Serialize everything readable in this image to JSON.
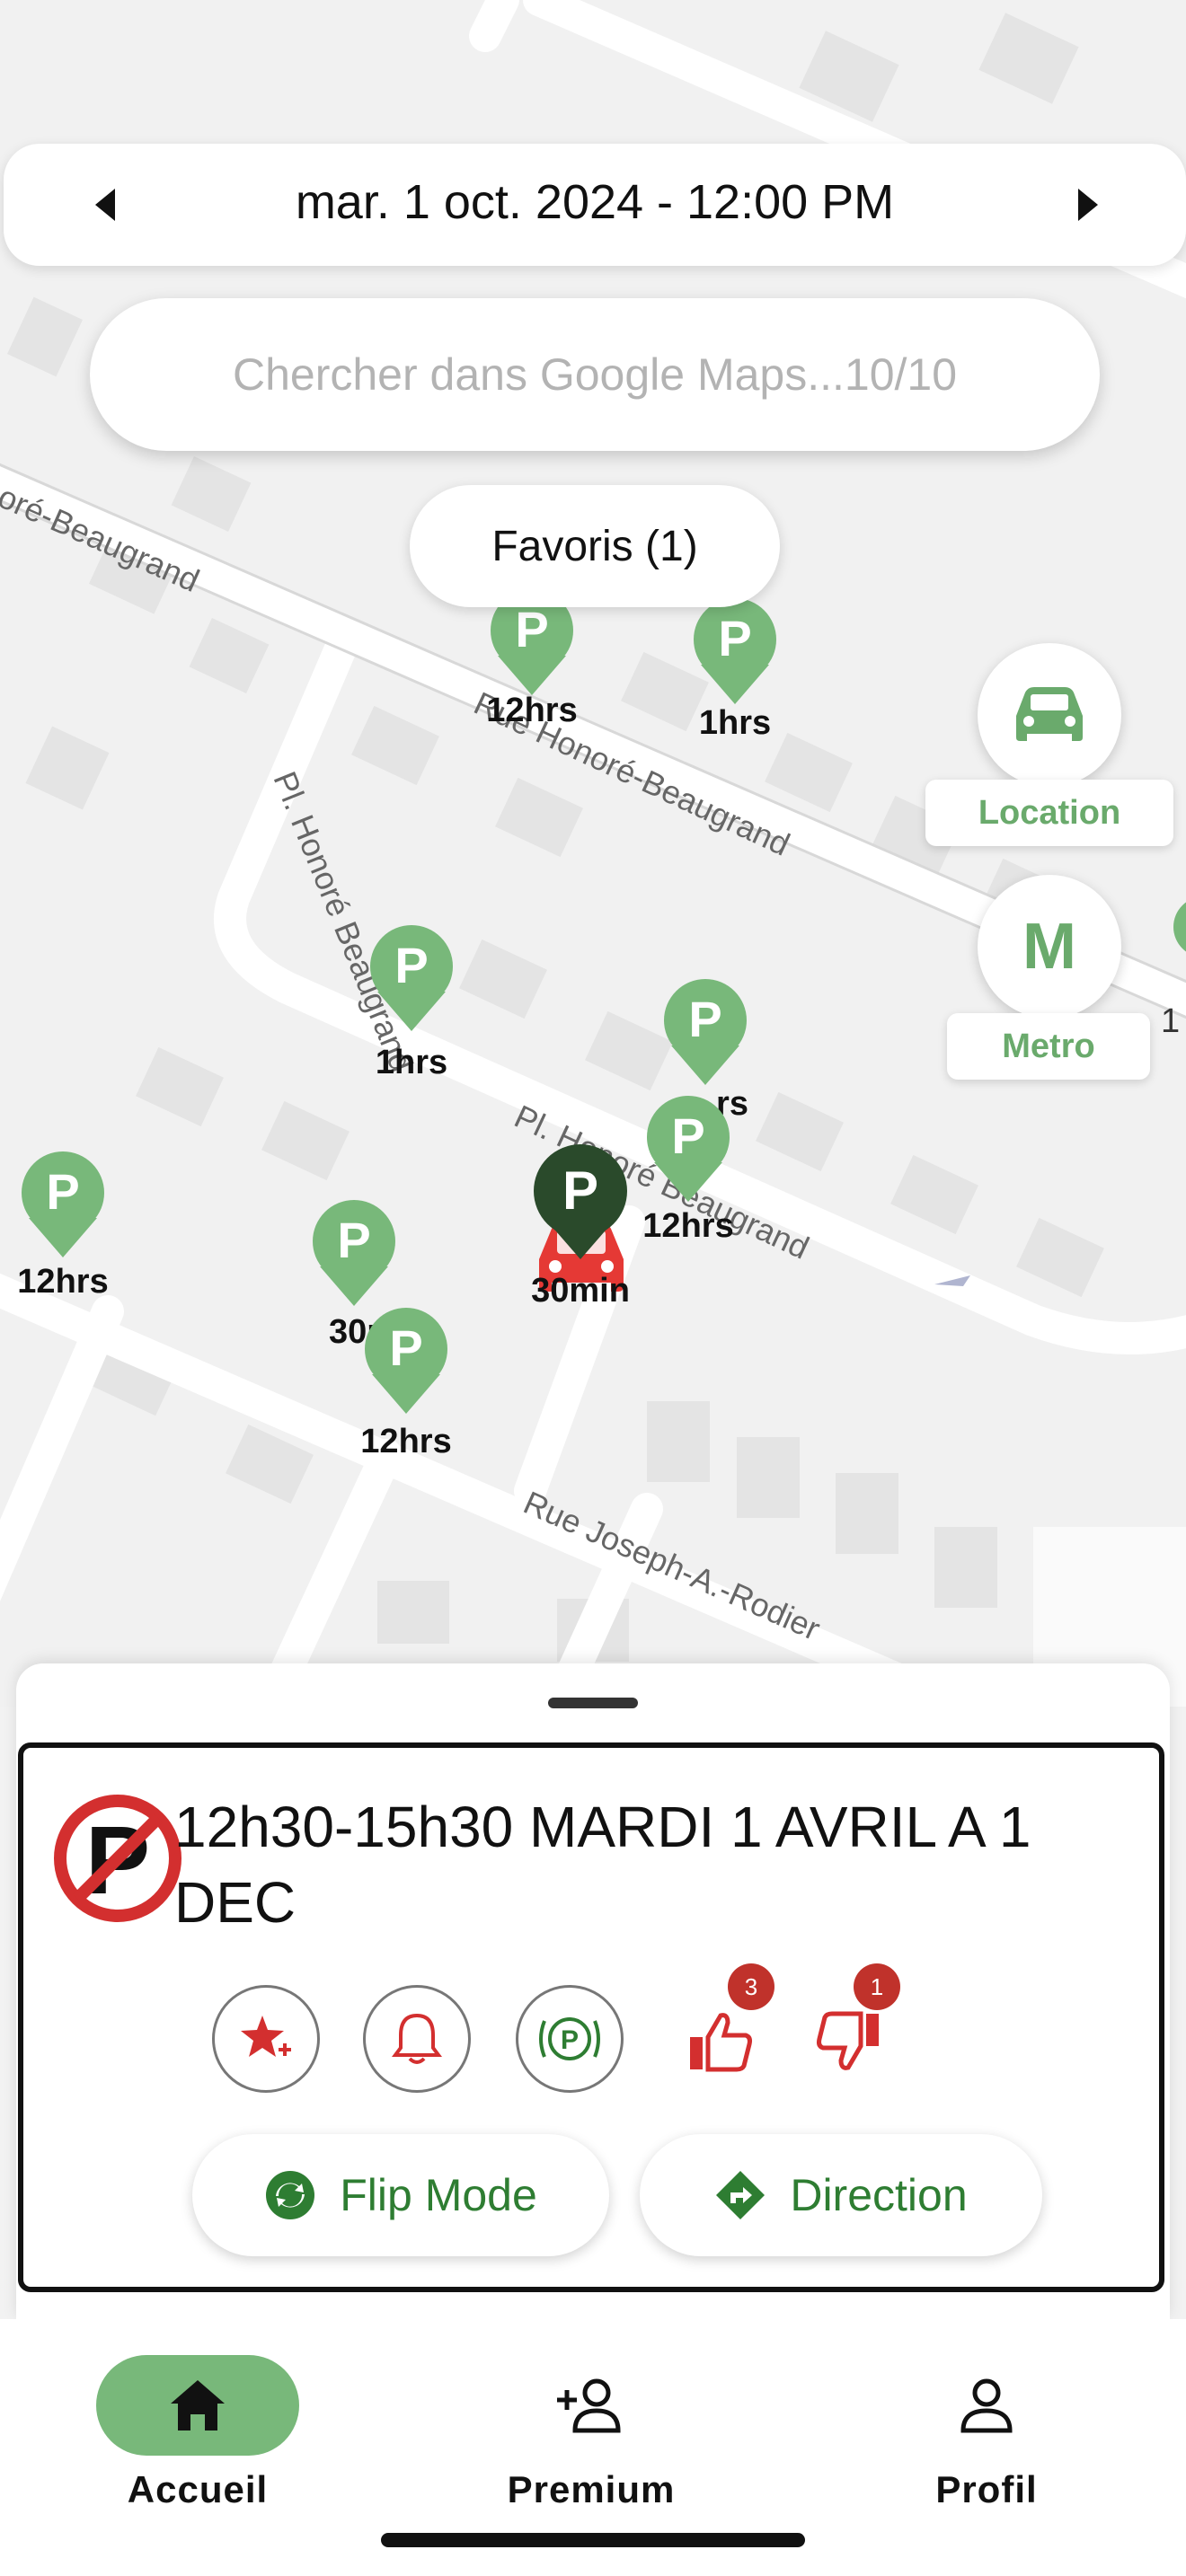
{
  "date_bar": {
    "text": "mar. 1 oct. 2024 - 12:00 PM"
  },
  "search": {
    "placeholder": "Chercher dans Google Maps...10/10"
  },
  "favorites": {
    "label": "Favoris (1)"
  },
  "streets": [
    "oré-Beaugrand",
    "Rue Honoré-Beaugrand",
    "Pl. Honoré Beaugrand",
    "Pl. Honoré Beaugrand",
    "Rue Joseph-A.-Rodier"
  ],
  "pins": [
    {
      "label": "12hrs",
      "color": "#78b87a"
    },
    {
      "label": "1hrs",
      "color": "#78b87a"
    },
    {
      "label": "1hrs",
      "color": "#78b87a"
    },
    {
      "label": "rs",
      "color": "#78b87a"
    },
    {
      "label": "12hrs",
      "color": "#78b87a"
    },
    {
      "label": "12hrs",
      "color": "#78b87a"
    },
    {
      "label": "30m",
      "color": "#78b87a"
    },
    {
      "label": "12hrs",
      "color": "#78b87a"
    },
    {
      "label": "30min",
      "color": "#2a4a2b"
    }
  ],
  "edge_label": "1",
  "side_buttons": {
    "location": {
      "label": "Location",
      "icon": "car-icon"
    },
    "metro": {
      "label": "Metro",
      "letter": "M"
    }
  },
  "sheet": {
    "title": "12h30-15h30 MARDI 1 AVRIL A 1 DEC",
    "icon": "no-parking-icon",
    "actions": [
      {
        "name": "favorite-add",
        "icon": "star-plus-icon"
      },
      {
        "name": "alarm",
        "icon": "bell-icon"
      },
      {
        "name": "parking",
        "icon": "parking-circle-icon"
      }
    ],
    "likes": "3",
    "dislikes": "1",
    "flip_label": "Flip Mode",
    "direction_label": "Direction"
  },
  "nav": {
    "home": "Accueil",
    "premium": "Premium",
    "profile": "Profil"
  },
  "colors": {
    "green": "#78b87a",
    "dark_green": "#2e7d32",
    "red": "#d32f2f"
  }
}
